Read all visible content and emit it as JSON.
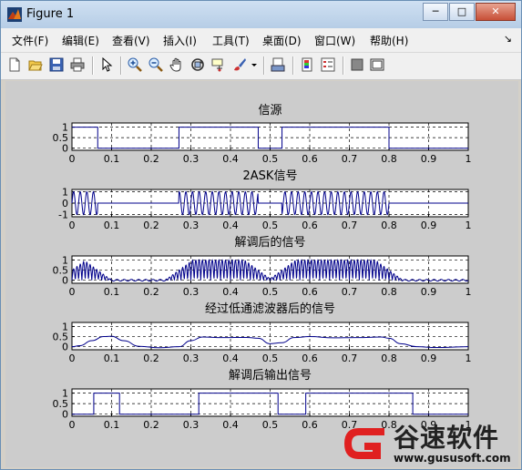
{
  "window": {
    "title": "Figure 1",
    "buttons": {
      "minimize": "─",
      "maximize": "□",
      "close": "✕"
    }
  },
  "menubar": {
    "items": [
      "文件(F)",
      "编辑(E)",
      "查看(V)",
      "插入(I)",
      "工具(T)",
      "桌面(D)",
      "窗口(W)",
      "帮助(H)"
    ],
    "overflow": "↘"
  },
  "toolbar": {
    "icons": [
      "new-figure-icon",
      "open-file-icon",
      "save-icon",
      "print-icon",
      "select-arrow-icon",
      "zoom-in-icon",
      "zoom-out-icon",
      "pan-hand-icon",
      "rotate-3d-icon",
      "data-cursor-icon",
      "brush-icon",
      "brush-dropdown-icon",
      "link-plot-icon",
      "colorbar-icon",
      "legend-icon",
      "hide-plot-tools-icon",
      "show-plot-tools-icon"
    ]
  },
  "plots": [
    {
      "title": "信源",
      "yticks": [
        "1",
        "0.5",
        "0"
      ],
      "ylim": [
        -0.1,
        1.2
      ]
    },
    {
      "title": "2ASK信号",
      "yticks": [
        "1",
        "0",
        "-1"
      ],
      "ylim": [
        -1.2,
        1.2
      ]
    },
    {
      "title": "解调后的信号",
      "yticks": [
        "1",
        "0.5",
        "0"
      ],
      "ylim": [
        -0.15,
        1.2
      ]
    },
    {
      "title": "经过低通滤波器后的信号",
      "yticks": [
        "1",
        "0.5",
        "0"
      ],
      "ylim": [
        -0.15,
        1.2
      ]
    },
    {
      "title": "解调后输出信号",
      "yticks": [
        "1",
        "0.5",
        "0"
      ],
      "ylim": [
        -0.1,
        1.2
      ]
    }
  ],
  "xticks": [
    "0",
    "0.1",
    "0.2",
    "0.3",
    "0.4",
    "0.5",
    "0.6",
    "0.7",
    "0.8",
    "0.9",
    "1"
  ],
  "chart_data": [
    {
      "type": "line",
      "title": "信源",
      "xlim": [
        0,
        1
      ],
      "ylim": [
        -0.1,
        1.2
      ],
      "grid": true,
      "series": [
        {
          "x": [
            0,
            0.065,
            0.065,
            0.27,
            0.27,
            0.47,
            0.47,
            0.53,
            0.53,
            0.8,
            0.8,
            1
          ],
          "y": [
            1,
            1,
            0,
            0,
            1,
            1,
            0,
            0,
            1,
            1,
            0,
            0
          ]
        }
      ]
    },
    {
      "type": "line",
      "title": "2ASK信号",
      "xlim": [
        0,
        1
      ],
      "ylim": [
        -1.2,
        1.2
      ],
      "grid": true,
      "carrier_cycles_per_unit": 60,
      "series": [
        {
          "envelope_x": [
            0,
            0.065,
            0.065,
            0.27,
            0.27,
            0.47,
            0.47,
            0.53,
            0.53,
            0.8,
            0.8,
            1
          ],
          "envelope_y": [
            1,
            1,
            0,
            0,
            1,
            1,
            0,
            0,
            1,
            1,
            0,
            0
          ]
        }
      ]
    },
    {
      "type": "line",
      "title": "解调后的信号",
      "xlim": [
        0,
        1
      ],
      "ylim": [
        -0.15,
        1.2
      ],
      "grid": true,
      "series": [
        {
          "segments": [
            [
              0,
              0.065
            ],
            [
              0.27,
              0.47
            ],
            [
              0.53,
              0.8
            ]
          ],
          "peak": 1,
          "rise": 0.035,
          "cycles_per_unit": 120
        }
      ]
    },
    {
      "type": "line",
      "title": "经过低通滤波器后的信号",
      "xlim": [
        0,
        1
      ],
      "ylim": [
        -0.15,
        1.2
      ],
      "grid": true,
      "series": [
        {
          "x": [
            0,
            0.02,
            0.05,
            0.08,
            0.1,
            0.13,
            0.17,
            0.22,
            0.27,
            0.3,
            0.33,
            0.38,
            0.44,
            0.47,
            0.5,
            0.53,
            0.56,
            0.6,
            0.66,
            0.72,
            0.78,
            0.8,
            0.83,
            0.87,
            0.92,
            1
          ],
          "y": [
            0,
            0.05,
            0.3,
            0.5,
            0.52,
            0.3,
            0.02,
            -0.05,
            0,
            0.3,
            0.48,
            0.45,
            0.46,
            0.42,
            0.15,
            0.2,
            0.45,
            0.5,
            0.44,
            0.45,
            0.48,
            0.42,
            0.15,
            0,
            -0.04,
            0
          ]
        }
      ]
    },
    {
      "type": "line",
      "title": "解调后输出信号",
      "xlim": [
        0,
        1
      ],
      "ylim": [
        -0.1,
        1.2
      ],
      "grid": true,
      "series": [
        {
          "x": [
            0,
            0.055,
            0.055,
            0.12,
            0.12,
            0.32,
            0.32,
            0.52,
            0.52,
            0.59,
            0.59,
            0.86,
            0.86,
            1
          ],
          "y": [
            0,
            0,
            1,
            1,
            0,
            0,
            1,
            1,
            0,
            0,
            1,
            1,
            0,
            0
          ]
        }
      ]
    }
  ],
  "watermark": {
    "text": "谷速软件",
    "url": "www.gususoft.com"
  }
}
